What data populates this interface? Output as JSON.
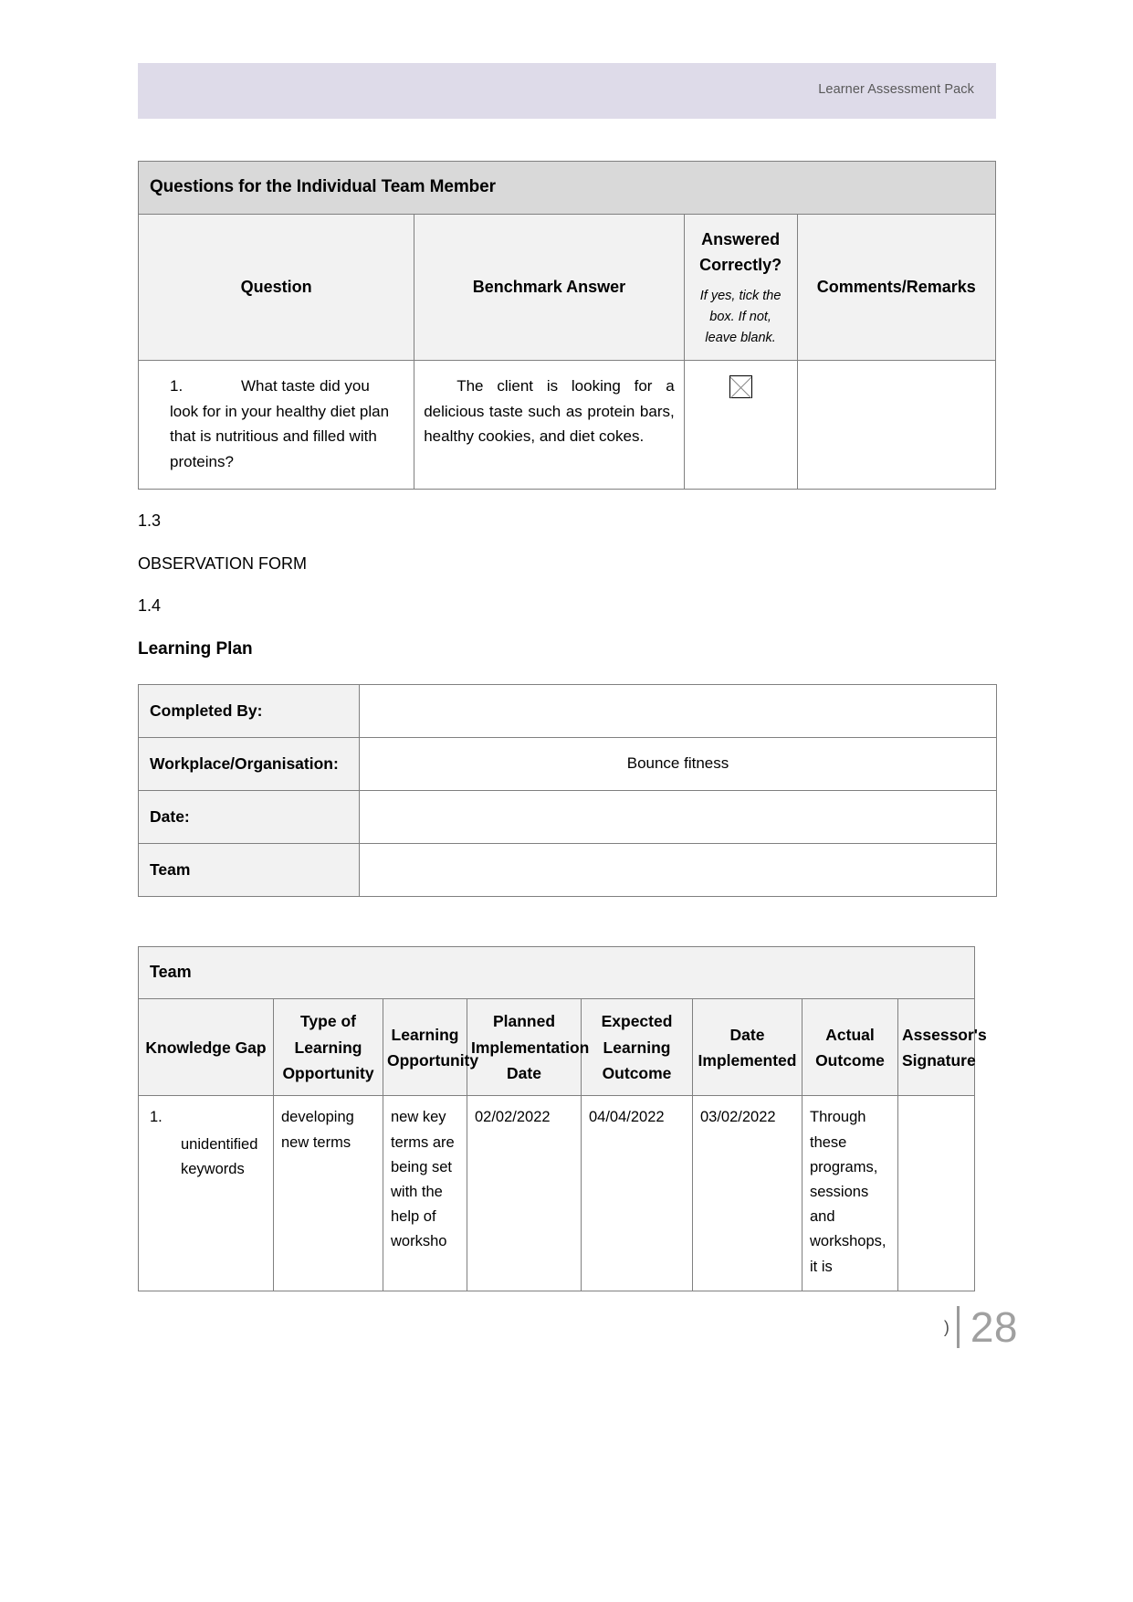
{
  "header": {
    "band_label": "Learner Assessment Pack",
    "band_color": "#dedbe9"
  },
  "questions_table": {
    "title": "Questions for the Individual Team Member",
    "columns": {
      "question": "Question",
      "benchmark": "Benchmark Answer",
      "answered_main": "Answered Correctly?",
      "answered_sub": "If yes, tick the box. If not, leave blank.",
      "comments": "Comments/Remarks"
    },
    "rows": [
      {
        "number": "1.",
        "question": "What taste did you look for in your healthy diet plan that is nutritious and filled with proteins?",
        "benchmark": "The client is looking for a delicious taste such as protein bars, healthy cookies, and diet cokes.",
        "answered_icon": "checkbox-x-icon",
        "comments": ""
      }
    ]
  },
  "sections": {
    "num_1_3": "1.3",
    "observation_form": "OBSERVATION FORM",
    "num_1_4": "1.4",
    "learning_plan": "Learning Plan"
  },
  "plan_table": {
    "rows": [
      {
        "label": "Completed By:",
        "value": ""
      },
      {
        "label": "Workplace/Organisation:",
        "value": "Bounce fitness"
      },
      {
        "label": "Date:",
        "value": ""
      },
      {
        "label": "Team",
        "value": ""
      }
    ]
  },
  "team_table": {
    "title": "Team",
    "columns": [
      "Knowledge Gap",
      "Type of Learning Opportunity",
      "Learning Opportunity",
      "Planned Implementation Date",
      "Expected Learning Outcome",
      "Date Implemented",
      "Actual Outcome",
      "Assessor's Signature"
    ],
    "rows": [
      {
        "number": "1.",
        "knowledge_gap": "unidentified keywords",
        "type_of_learning_opportunity": "developing new terms",
        "learning_opportunity": "new key terms are being set with the help of worksho",
        "planned_implementation_date": "02/02/2022",
        "expected_learning_outcome": "04/04/2022",
        "date_implemented": "03/02/2022",
        "actual_outcome": "Through these programs, sessions and workshops, it is",
        "assessor_signature": ""
      }
    ]
  },
  "footer": {
    "tail_glyph": ")",
    "page_number": "28"
  }
}
